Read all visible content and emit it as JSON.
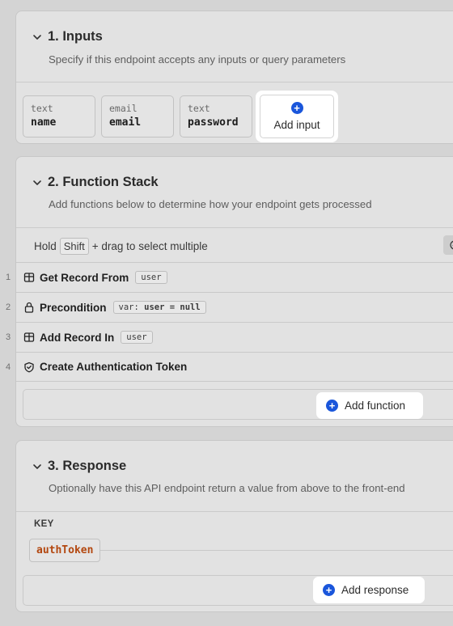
{
  "inputs_section": {
    "title": "1. Inputs",
    "description": "Specify if this endpoint accepts any inputs or query parameters",
    "inputs": [
      {
        "type": "text",
        "name": "name"
      },
      {
        "type": "email",
        "name": "email"
      },
      {
        "type": "text",
        "name": "password"
      }
    ],
    "add_label": "Add input"
  },
  "function_section": {
    "title": "2. Function Stack",
    "description": "Add functions below to determine how your endpoint gets processed",
    "hint_prefix": "Hold",
    "hint_key": "Shift",
    "hint_suffix": "+ drag to select multiple",
    "functions": [
      {
        "number": "1",
        "icon": "table-icon",
        "label": "Get Record From",
        "tag": "user"
      },
      {
        "number": "2",
        "icon": "lock-icon",
        "label": "Precondition",
        "tag_prefix": "var:",
        "tag_var": "user",
        "tag_suffix": "= null"
      },
      {
        "number": "3",
        "icon": "table-icon",
        "label": "Add Record In",
        "tag": "user"
      },
      {
        "number": "4",
        "icon": "shield-check-icon",
        "label": "Create Authentication Token"
      }
    ],
    "add_label": "Add function"
  },
  "response_section": {
    "title": "3. Response",
    "description": "Optionally have this API endpoint return a value from above to the front-end",
    "key_header": "KEY",
    "keys": [
      "authToken"
    ],
    "add_label": "Add response"
  },
  "colors": {
    "accent": "#1a56db",
    "key_text": "#b3470f"
  }
}
